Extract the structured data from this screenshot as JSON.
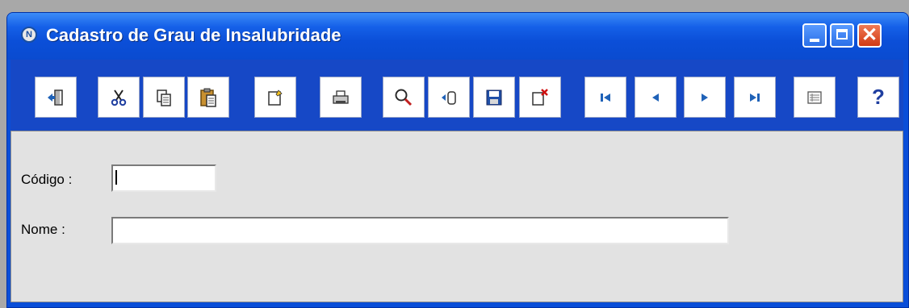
{
  "window": {
    "title": "Cadastro de Grau de Insalubridade",
    "app_icon_letter": "N",
    "controls": [
      "minimize-icon",
      "maximize-icon",
      "close-icon"
    ]
  },
  "toolbar": {
    "buttons": [
      {
        "name": "exit",
        "icon": "exit-door-icon"
      },
      {
        "name": "cut",
        "icon": "scissors-icon"
      },
      {
        "name": "copy",
        "icon": "copy-icon"
      },
      {
        "name": "paste",
        "icon": "paste-icon"
      },
      {
        "name": "new",
        "icon": "new-record-icon"
      },
      {
        "name": "print",
        "icon": "printer-icon"
      },
      {
        "name": "search",
        "icon": "magnifier-icon"
      },
      {
        "name": "insert",
        "icon": "insert-record-icon"
      },
      {
        "name": "save",
        "icon": "floppy-disk-icon"
      },
      {
        "name": "delete",
        "icon": "delete-record-icon"
      },
      {
        "name": "first",
        "icon": "first-record-icon"
      },
      {
        "name": "previous",
        "icon": "previous-record-icon"
      },
      {
        "name": "next",
        "icon": "next-record-icon"
      },
      {
        "name": "last",
        "icon": "last-record-icon"
      },
      {
        "name": "list",
        "icon": "table-view-icon"
      },
      {
        "name": "help",
        "icon": "help-icon"
      }
    ],
    "help_glyph": "?"
  },
  "form": {
    "codigo_label": "Código :",
    "codigo_value": "",
    "nome_label": "Nome :",
    "nome_value": ""
  },
  "colors": {
    "titlebar": "#0a4ed8",
    "toolbar": "#1648c6",
    "content_bg": "#e2e2e2",
    "nav_arrow": "#1f62b8",
    "delete_x": "#d01010"
  }
}
